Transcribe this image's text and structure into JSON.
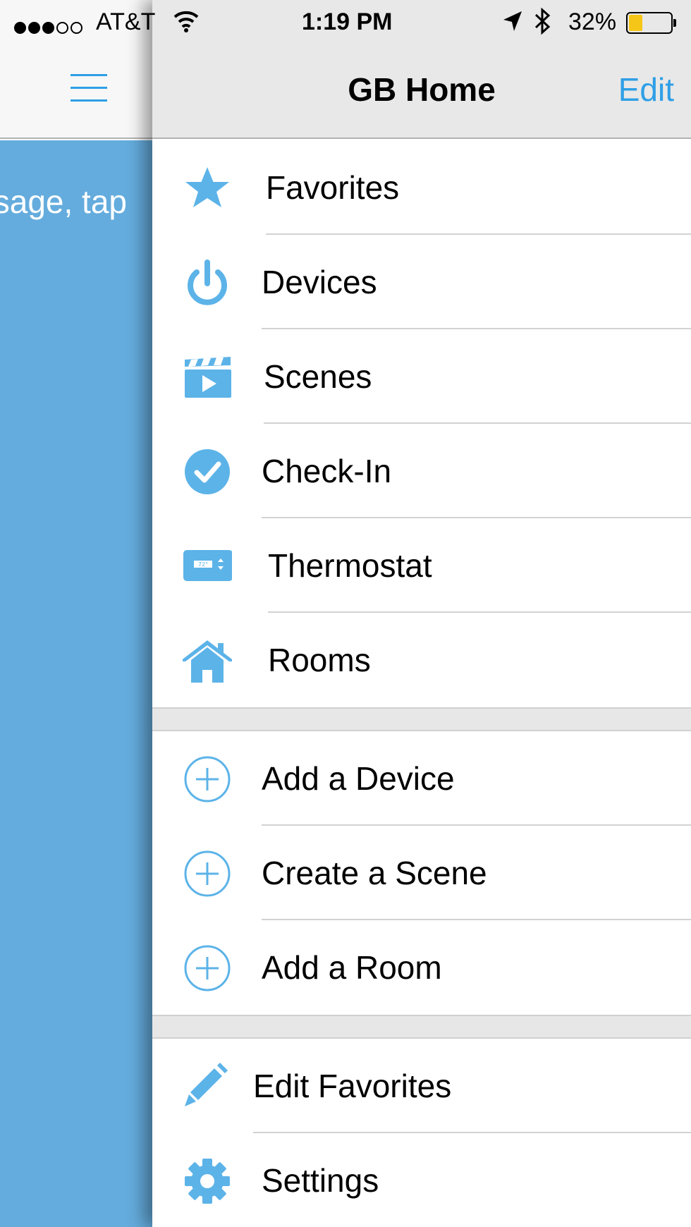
{
  "status_bar": {
    "signal_filled": 3,
    "signal_empty": 2,
    "carrier": "AT&T",
    "time": "1:19 PM",
    "battery_percent": "32%",
    "battery_level": 0.32,
    "battery_color": "#f5c518"
  },
  "left_panel": {
    "partial_text": "sage, tap",
    "color": "#64acdd"
  },
  "header": {
    "title": "GB Home",
    "edit_label": "Edit"
  },
  "menu": {
    "accent_color": "#5cb3e8",
    "main_items": [
      {
        "label": "Favorites",
        "icon": "star-icon"
      },
      {
        "label": "Devices",
        "icon": "power-icon"
      },
      {
        "label": "Scenes",
        "icon": "clapperboard-icon"
      },
      {
        "label": "Check-In",
        "icon": "checkmark-circle-icon"
      },
      {
        "label": "Thermostat",
        "icon": "thermostat-icon",
        "icon_text": "72°"
      },
      {
        "label": "Rooms",
        "icon": "house-icon"
      }
    ],
    "add_items": [
      {
        "label": "Add a Device",
        "icon": "plus-circle-icon"
      },
      {
        "label": "Create a Scene",
        "icon": "plus-circle-icon"
      },
      {
        "label": "Add a Room",
        "icon": "plus-circle-icon"
      }
    ],
    "tool_items": [
      {
        "label": "Edit Favorites",
        "icon": "pencil-icon"
      },
      {
        "label": "Settings",
        "icon": "gear-icon"
      }
    ]
  }
}
